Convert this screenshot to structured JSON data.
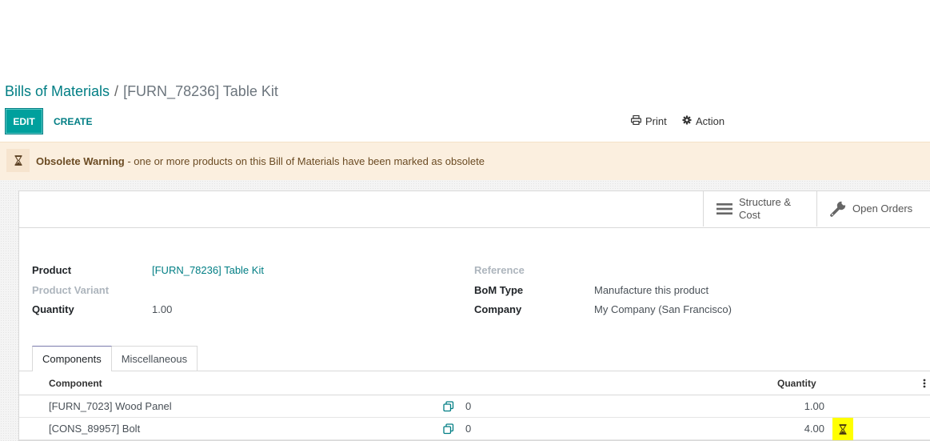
{
  "breadcrumb": {
    "parent": "Bills of Materials",
    "separator": "/",
    "current": "[FURN_78236] Table Kit"
  },
  "control_panel": {
    "edit_label": "EDIT",
    "create_label": "CREATE",
    "print_label": "Print",
    "action_label": "Action"
  },
  "alert": {
    "title": "Obsolete Warning",
    "message": " - one or more products on this Bill of Materials have been marked as obsolete"
  },
  "smart_buttons": {
    "structure_line1": "Structure &",
    "structure_line2": "Cost",
    "open_orders": "Open Orders"
  },
  "form": {
    "product_label": "Product",
    "product_value": "[FURN_78236] Table Kit",
    "variant_label": "Product Variant",
    "quantity_label": "Quantity",
    "quantity_value": "1.00",
    "reference_label": "Reference",
    "bom_type_label": "BoM Type",
    "bom_type_value": "Manufacture this product",
    "company_label": "Company",
    "company_value": "My Company (San Francisco)"
  },
  "tabs": {
    "components": "Components",
    "misc": "Miscellaneous"
  },
  "table": {
    "col_component": "Component",
    "col_quantity": "Quantity",
    "rows": [
      {
        "component": "[FURN_7023] Wood Panel",
        "count": "0",
        "quantity": "1.00"
      },
      {
        "component": "[CONS_89957] Bolt",
        "count": "0",
        "quantity": "4.00"
      }
    ]
  },
  "colors": {
    "brand": "#017e84",
    "primary_button": "#00a09d",
    "warning_bg": "#fbefdf",
    "obsolete_highlight": "#ffff00"
  }
}
